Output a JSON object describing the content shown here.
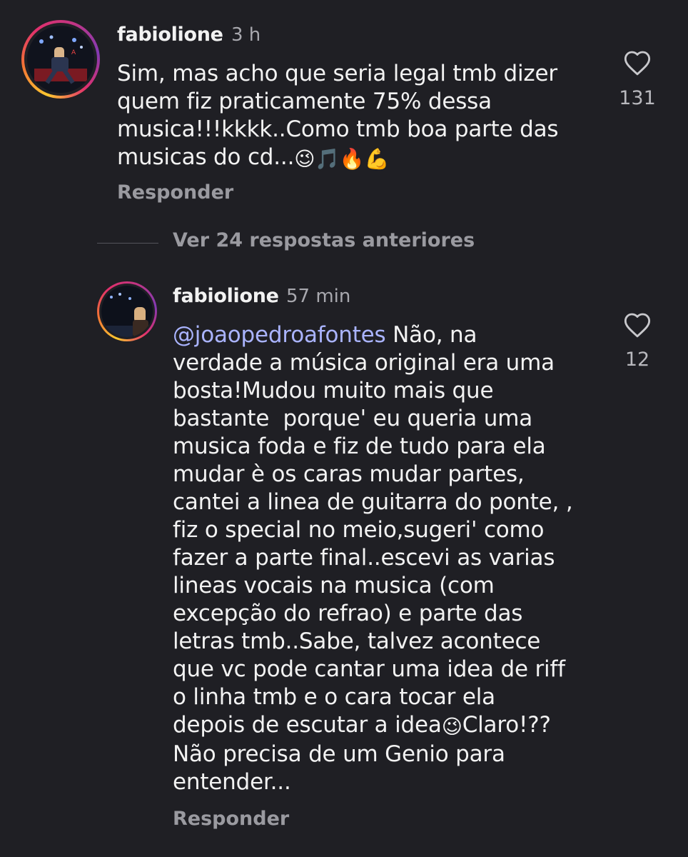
{
  "comment_1": {
    "username": "fabiolione",
    "time": "3 h",
    "lines": [
      "Sim, mas acho que seria legal tmb dizer",
      "quem fiz praticamente 75% dessa",
      "musica!!!kkkk..Como tmb boa parte das",
      "musicas do cd..."
    ],
    "emojis": [
      "😉",
      "🎵",
      "🔥",
      "💪"
    ],
    "reply_label": "Responder",
    "like_icon": "heart-outline-icon",
    "like_count": "131"
  },
  "view_replies_label": "Ver 24 respostas anteriores",
  "comment_2": {
    "username": "fabiolione",
    "time": "57 min",
    "mention": "@joaopedroafontes",
    "first_line_rest": " Não, na",
    "lines": [
      "verdade a música original era uma",
      "bosta!Mudou muito mais que",
      "bastante  porque' eu queria uma",
      "musica foda e fiz de tudo para ela",
      "mudar è os caras mudar partes,",
      "cantei a linea de guitarra do ponte, ,",
      "fiz o special no meio,sugeri' como",
      "fazer a parte final..escevi as varias",
      "lineas vocais na musica (com",
      "excepção do refrao) e parte das",
      "letras tmb..Sabe, talvez acontece",
      "que vc pode cantar uma idea de riff",
      "o linha tmb e o cara tocar ela"
    ],
    "line_with_emoji_before": "depois de escutar a idea",
    "line_emoji": "😉",
    "line_with_emoji_after": "Claro!??",
    "lines_end": [
      "Não precisa de um Genio para",
      "entender..."
    ],
    "reply_label": "Responder",
    "like_icon": "heart-outline-icon",
    "like_count": "12"
  },
  "colors": {
    "background": "#1f1f24",
    "text": "#f2f2f2",
    "muted": "#9a9aa0",
    "mention": "#aab4ff"
  }
}
